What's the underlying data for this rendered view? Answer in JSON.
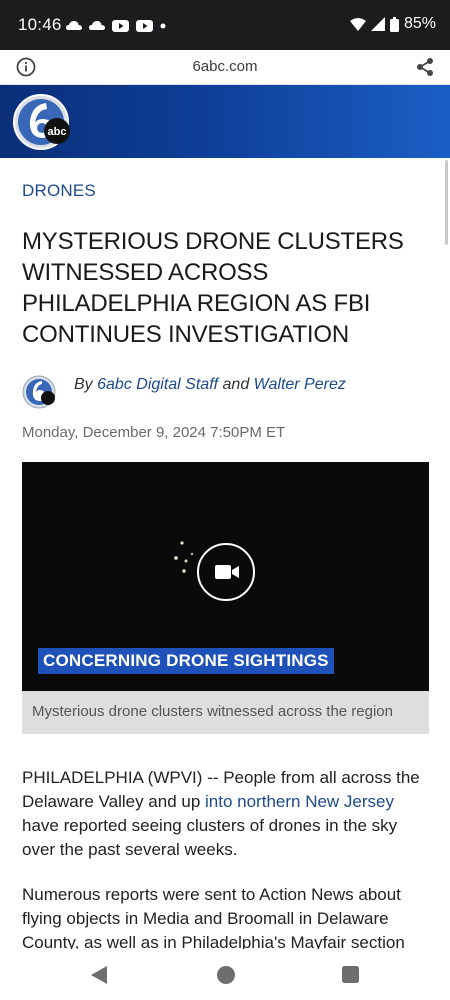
{
  "status_bar": {
    "time": "10:46",
    "battery": "85%"
  },
  "browser": {
    "url": "6abc.com"
  },
  "brand": {
    "logo_text": "abc"
  },
  "article": {
    "category": "DRONES",
    "headline": "MYSTERIOUS DRONE CLUSTERS WITNESSED ACROSS PHILADELPHIA REGION AS FBI CONTINUES INVESTIGATION",
    "byline_prefix": "By ",
    "author1": "6abc Digital Staff",
    "byline_and": " and ",
    "author2": "Walter Perez",
    "date": "Monday, December 9, 2024 7:50PM ET",
    "video": {
      "overlay_text": "CONCERNING DRONE SIGHTINGS",
      "caption": "Mysterious drone clusters witnessed across the region"
    },
    "p1_start": "PHILADELPHIA (WPVI) -- People from all across the Delaware Valley and up ",
    "p1_link": "into northern New Jersey",
    "p1_end": " have reported seeing clusters of drones in the sky over the past several weeks.",
    "p2": "Numerous reports were sent to Action News about flying objects in Media and Broomall in Delaware County, as well as in Philadelphia's Mayfair section"
  },
  "colors": {
    "link": "#1d4a8a",
    "header_blue": "#0e3e98",
    "lower_third": "#1e52b8"
  }
}
